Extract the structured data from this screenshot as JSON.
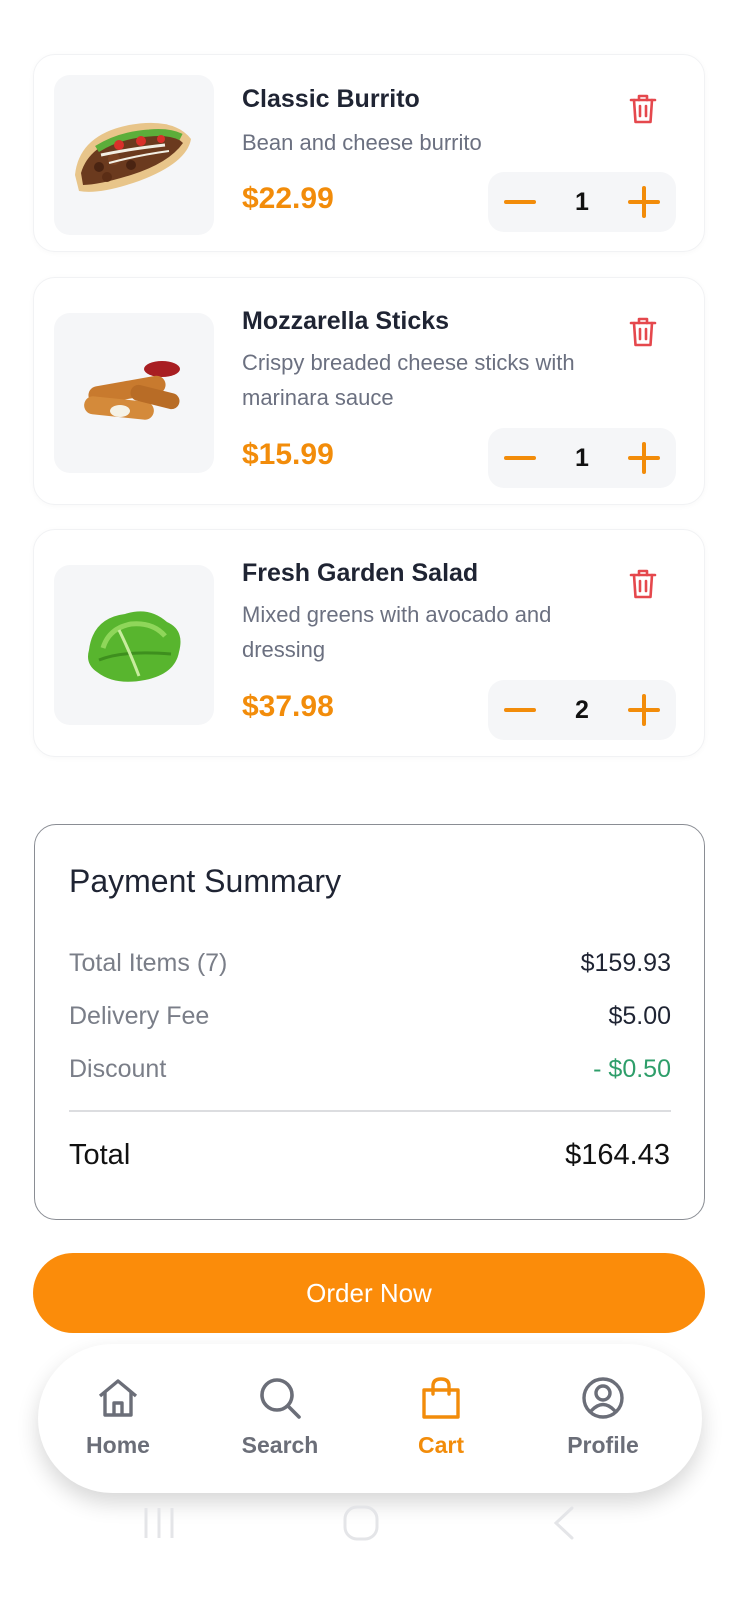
{
  "cart": {
    "items": [
      {
        "name": "Classic Burrito",
        "description": "Bean and cheese burrito",
        "price": "$22.99",
        "quantity": "1",
        "image_icon": "burrito-image"
      },
      {
        "name": "Mozzarella Sticks",
        "description": "Crispy breaded cheese sticks with marinara sauce",
        "price": "$15.99",
        "quantity": "1",
        "image_icon": "mozzarella-sticks-image"
      },
      {
        "name": "Fresh Garden Salad",
        "description": "Mixed greens with avocado and dressing",
        "price": "$37.98",
        "quantity": "2",
        "image_icon": "salad-image"
      }
    ]
  },
  "summary": {
    "title": "Payment Summary",
    "items_label": "Total Items (7)",
    "items_value": "$159.93",
    "delivery_label": "Delivery Fee",
    "delivery_value": "$5.00",
    "discount_label": "Discount",
    "discount_value": "- $0.50",
    "total_label": "Total",
    "total_value": "$164.43"
  },
  "order_button": {
    "label": "Order Now"
  },
  "nav": {
    "items": [
      {
        "label": "Home",
        "icon": "home-icon"
      },
      {
        "label": "Search",
        "icon": "search-icon"
      },
      {
        "label": "Cart",
        "icon": "shopping-bag-icon"
      },
      {
        "label": "Profile",
        "icon": "profile-icon"
      }
    ],
    "active": "Cart"
  },
  "colors": {
    "accent": "#fb8c0a",
    "price": "#f28c0a",
    "delete": "#e5484d",
    "discount": "#2e9e6a",
    "nav_inactive": "#6b6e78"
  }
}
